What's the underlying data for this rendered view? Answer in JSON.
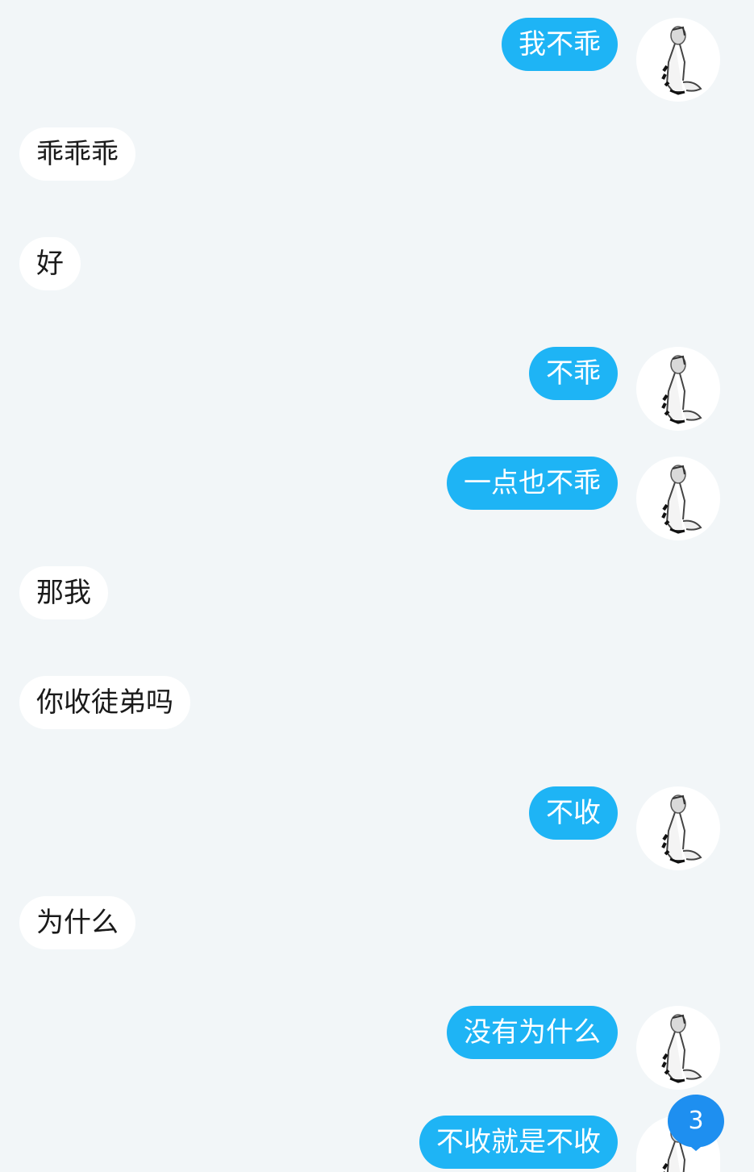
{
  "conversation": {
    "messages": [
      {
        "side": "out",
        "text": "我不乖"
      },
      {
        "side": "in",
        "text": "乖乖乖"
      },
      {
        "side": "in",
        "text": "好"
      },
      {
        "side": "out",
        "text": "不乖"
      },
      {
        "side": "out",
        "text": "一点也不乖"
      },
      {
        "side": "in",
        "text": "那我"
      },
      {
        "side": "in",
        "text": "你收徒弟吗"
      },
      {
        "side": "out",
        "text": "不收"
      },
      {
        "side": "in",
        "text": "为什么"
      },
      {
        "side": "out",
        "text": "没有为什么"
      },
      {
        "side": "out",
        "text": "不收就是不收"
      }
    ]
  },
  "unread_badge": {
    "count": "3"
  },
  "colors": {
    "background": "#f2f6f8",
    "outgoing_bubble": "#1eb4f5",
    "incoming_bubble": "#ffffff",
    "badge": "#1e8ff0"
  },
  "icons": {
    "avatar": "user-avatar-figure",
    "badge": "unread-count-badge"
  }
}
